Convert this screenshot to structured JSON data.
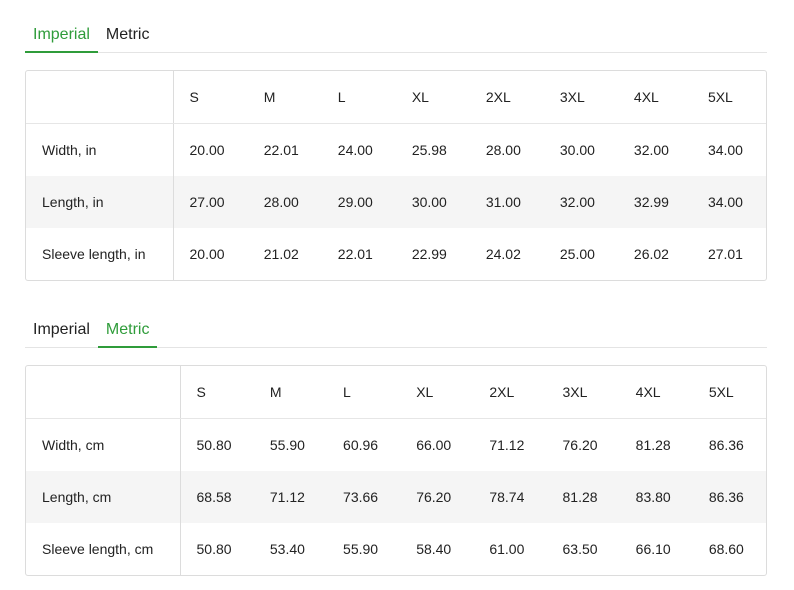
{
  "section1": {
    "tabs": [
      {
        "label": "Imperial",
        "active": true
      },
      {
        "label": "Metric",
        "active": false
      }
    ],
    "sizes": [
      "S",
      "M",
      "L",
      "XL",
      "2XL",
      "3XL",
      "4XL",
      "5XL"
    ],
    "rows": [
      {
        "label": "Width, in",
        "values": [
          "20.00",
          "22.01",
          "24.00",
          "25.98",
          "28.00",
          "30.00",
          "32.00",
          "34.00"
        ]
      },
      {
        "label": "Length, in",
        "values": [
          "27.00",
          "28.00",
          "29.00",
          "30.00",
          "31.00",
          "32.00",
          "32.99",
          "34.00"
        ]
      },
      {
        "label": "Sleeve length, in",
        "values": [
          "20.00",
          "21.02",
          "22.01",
          "22.99",
          "24.02",
          "25.00",
          "26.02",
          "27.01"
        ]
      }
    ]
  },
  "section2": {
    "tabs": [
      {
        "label": "Imperial",
        "active": false
      },
      {
        "label": "Metric",
        "active": true
      }
    ],
    "sizes": [
      "S",
      "M",
      "L",
      "XL",
      "2XL",
      "3XL",
      "4XL",
      "5XL"
    ],
    "rows": [
      {
        "label": "Width, cm",
        "values": [
          "50.80",
          "55.90",
          "60.96",
          "66.00",
          "71.12",
          "76.20",
          "81.28",
          "86.36"
        ]
      },
      {
        "label": "Length, cm",
        "values": [
          "68.58",
          "71.12",
          "73.66",
          "76.20",
          "78.74",
          "81.28",
          "83.80",
          "86.36"
        ]
      },
      {
        "label": "Sleeve length, cm",
        "values": [
          "50.80",
          "53.40",
          "55.90",
          "58.40",
          "61.00",
          "63.50",
          "66.10",
          "68.60"
        ]
      }
    ]
  },
  "colors": {
    "accent": "#2f9c3a",
    "row_alt": "#f5f5f5",
    "border": "#dcdcdc"
  }
}
